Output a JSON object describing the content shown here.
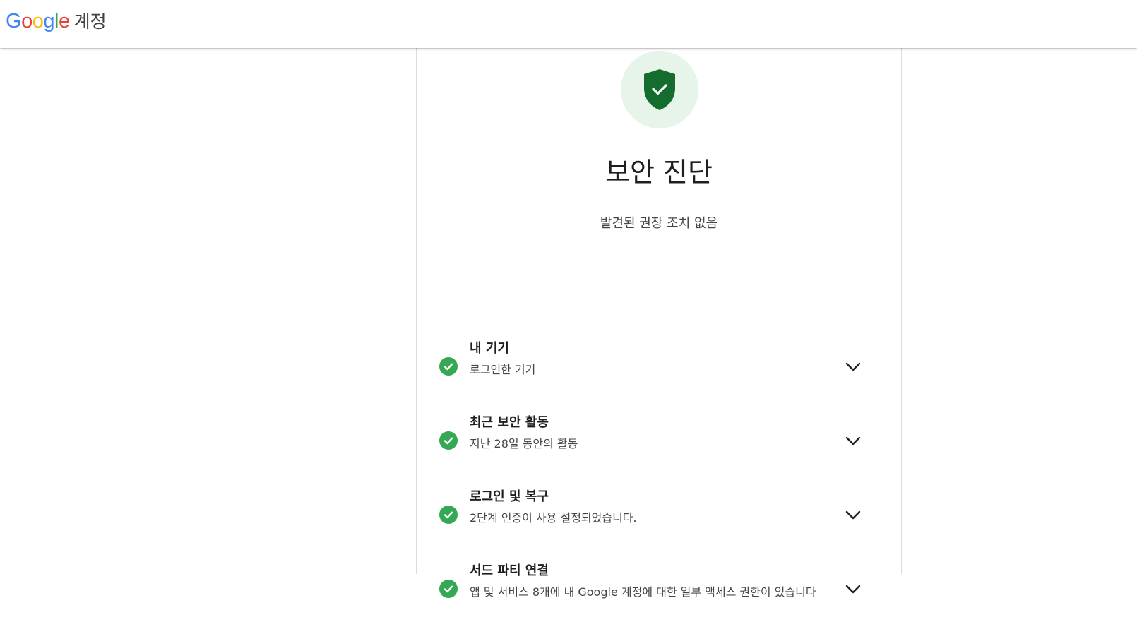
{
  "header": {
    "logo_letters": [
      "G",
      "o",
      "o",
      "g",
      "l",
      "e"
    ],
    "logo_colors": [
      "#4285F4",
      "#EA4335",
      "#FBBC05",
      "#4285F4",
      "#34A853",
      "#EA4335"
    ],
    "product_name": "계정"
  },
  "main": {
    "hero_icon": "shield-check-icon",
    "title": "보안 진단",
    "subtitle": "발견된 권장 조치 없음",
    "items": [
      {
        "title": "내 기기",
        "description": "로그인한 기기",
        "status_icon": "check-circle-icon",
        "expand_icon": "chevron-down-icon"
      },
      {
        "title": "최근 보안 활동",
        "description": "지난 28일 동안의 활동",
        "status_icon": "check-circle-icon",
        "expand_icon": "chevron-down-icon"
      },
      {
        "title": "로그인 및 복구",
        "description": "2단계 인증이 사용 설정되었습니다.",
        "status_icon": "check-circle-icon",
        "expand_icon": "chevron-down-icon"
      },
      {
        "title": "서드 파티 연결",
        "description": "앱 및 서비스 8개에 내 Google 계정에 대한 일부 액세스 권한이 있습니다",
        "status_icon": "check-circle-icon",
        "expand_icon": "chevron-down-icon"
      }
    ]
  },
  "colors": {
    "shield": "#146c2e",
    "hero_bg": "#e6f4ea",
    "check": "#34a853"
  }
}
